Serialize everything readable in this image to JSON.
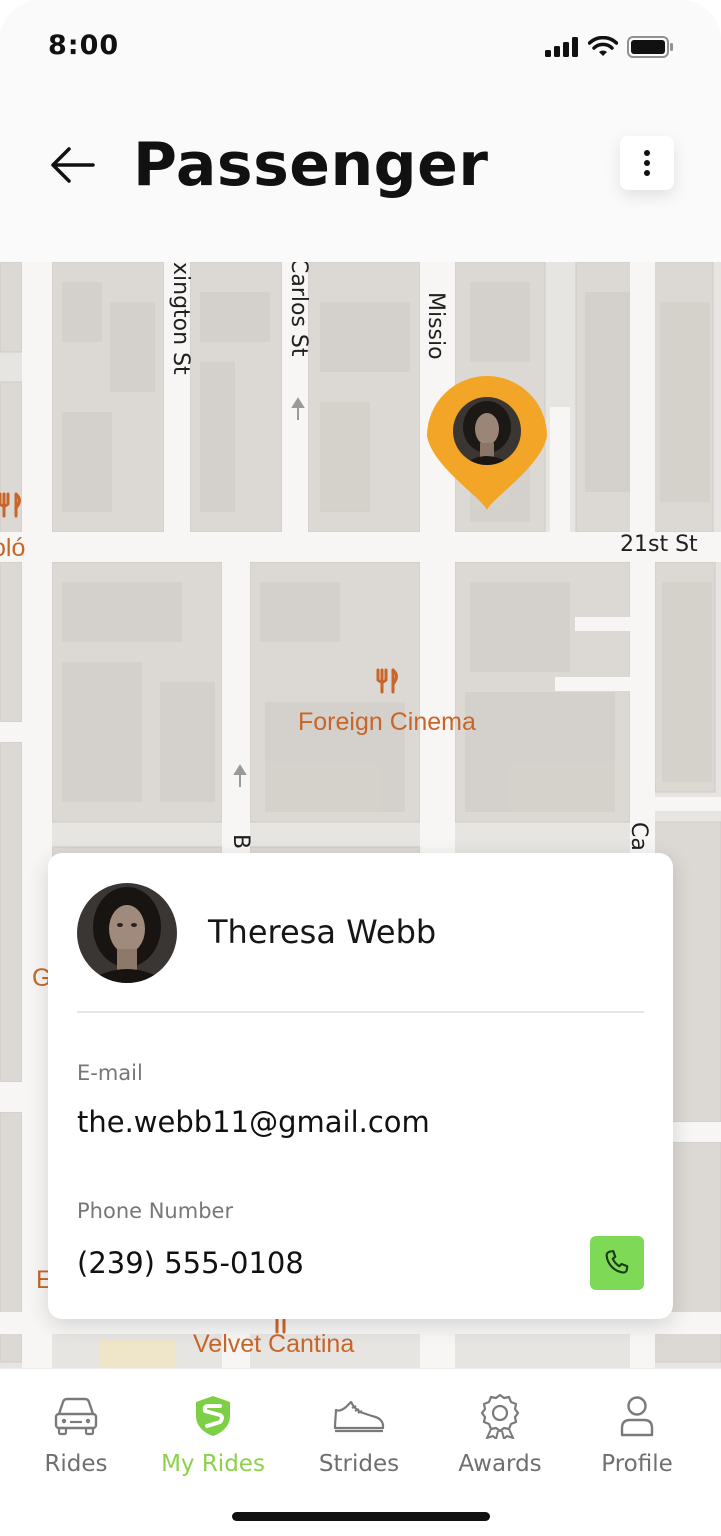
{
  "status_bar": {
    "time": "8:00"
  },
  "header": {
    "title": "Passenger"
  },
  "map": {
    "streets": [
      "xington St",
      "Carlos St",
      "Missio",
      "21st St",
      "Ca",
      "B"
    ],
    "pois": [
      "Foreign Cinema",
      "Velvet Cantina",
      "oló",
      "G",
      "E"
    ]
  },
  "passenger": {
    "name": "Theresa Webb",
    "email_label": "E-mail",
    "email": "the.webb11@gmail.com",
    "phone_label": "Phone Number",
    "phone": "(239) 555-0108"
  },
  "tabs": [
    {
      "label": "Rides",
      "icon": "car-icon",
      "active": false
    },
    {
      "label": "My Rides",
      "icon": "strides-logo-icon",
      "active": true
    },
    {
      "label": "Strides",
      "icon": "sneaker-icon",
      "active": false
    },
    {
      "label": "Awards",
      "icon": "award-icon",
      "active": false
    },
    {
      "label": "Profile",
      "icon": "user-icon",
      "active": false
    }
  ],
  "colors": {
    "accent": "#8dd14a",
    "pin": "#f2a526",
    "call": "#7ed957",
    "poi": "#c8662a"
  }
}
